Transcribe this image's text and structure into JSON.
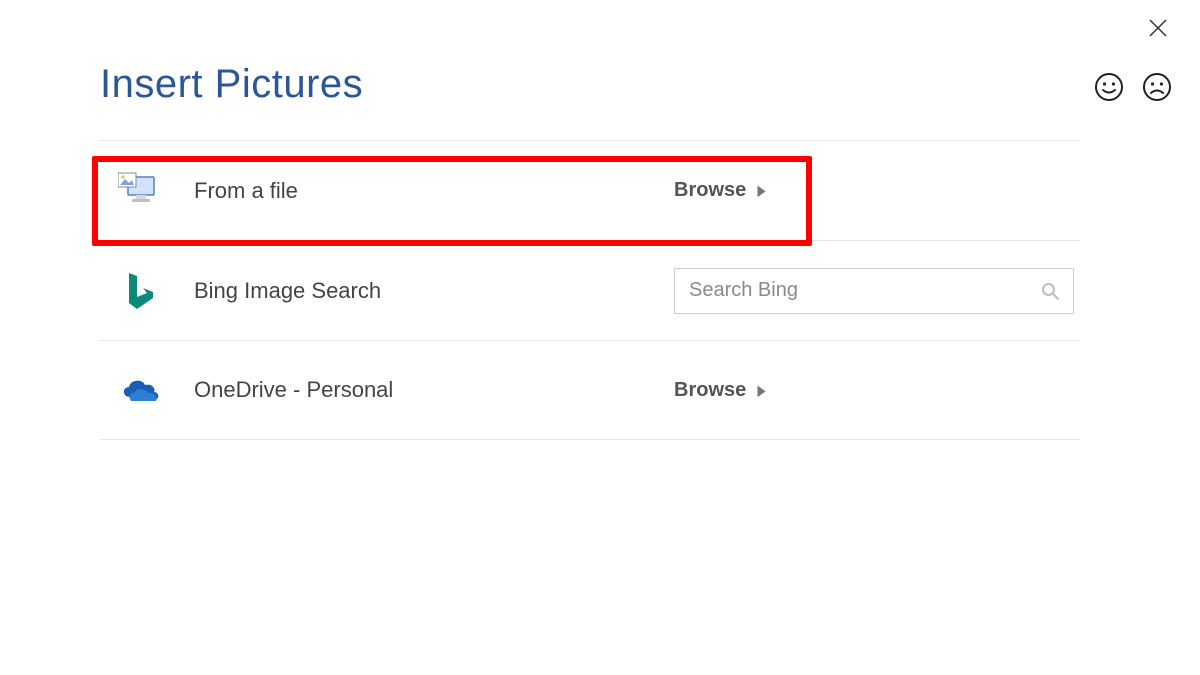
{
  "dialog": {
    "title": "Insert Pictures"
  },
  "options": {
    "from_file": {
      "label": "From a file",
      "action": "Browse"
    },
    "bing": {
      "label": "Bing Image Search",
      "search_placeholder": "Search Bing"
    },
    "onedrive": {
      "label": "OneDrive - Personal",
      "action": "Browse"
    }
  },
  "colors": {
    "accent": "#2b579a",
    "highlight": "#ff0000"
  },
  "icons": {
    "close": "close-icon",
    "smile": "smile-icon",
    "frown": "frown-icon",
    "file_source": "computer-photo-icon",
    "bing": "bing-logo-icon",
    "onedrive": "onedrive-cloud-icon",
    "search": "search-icon",
    "chevron": "chevron-right-icon"
  }
}
